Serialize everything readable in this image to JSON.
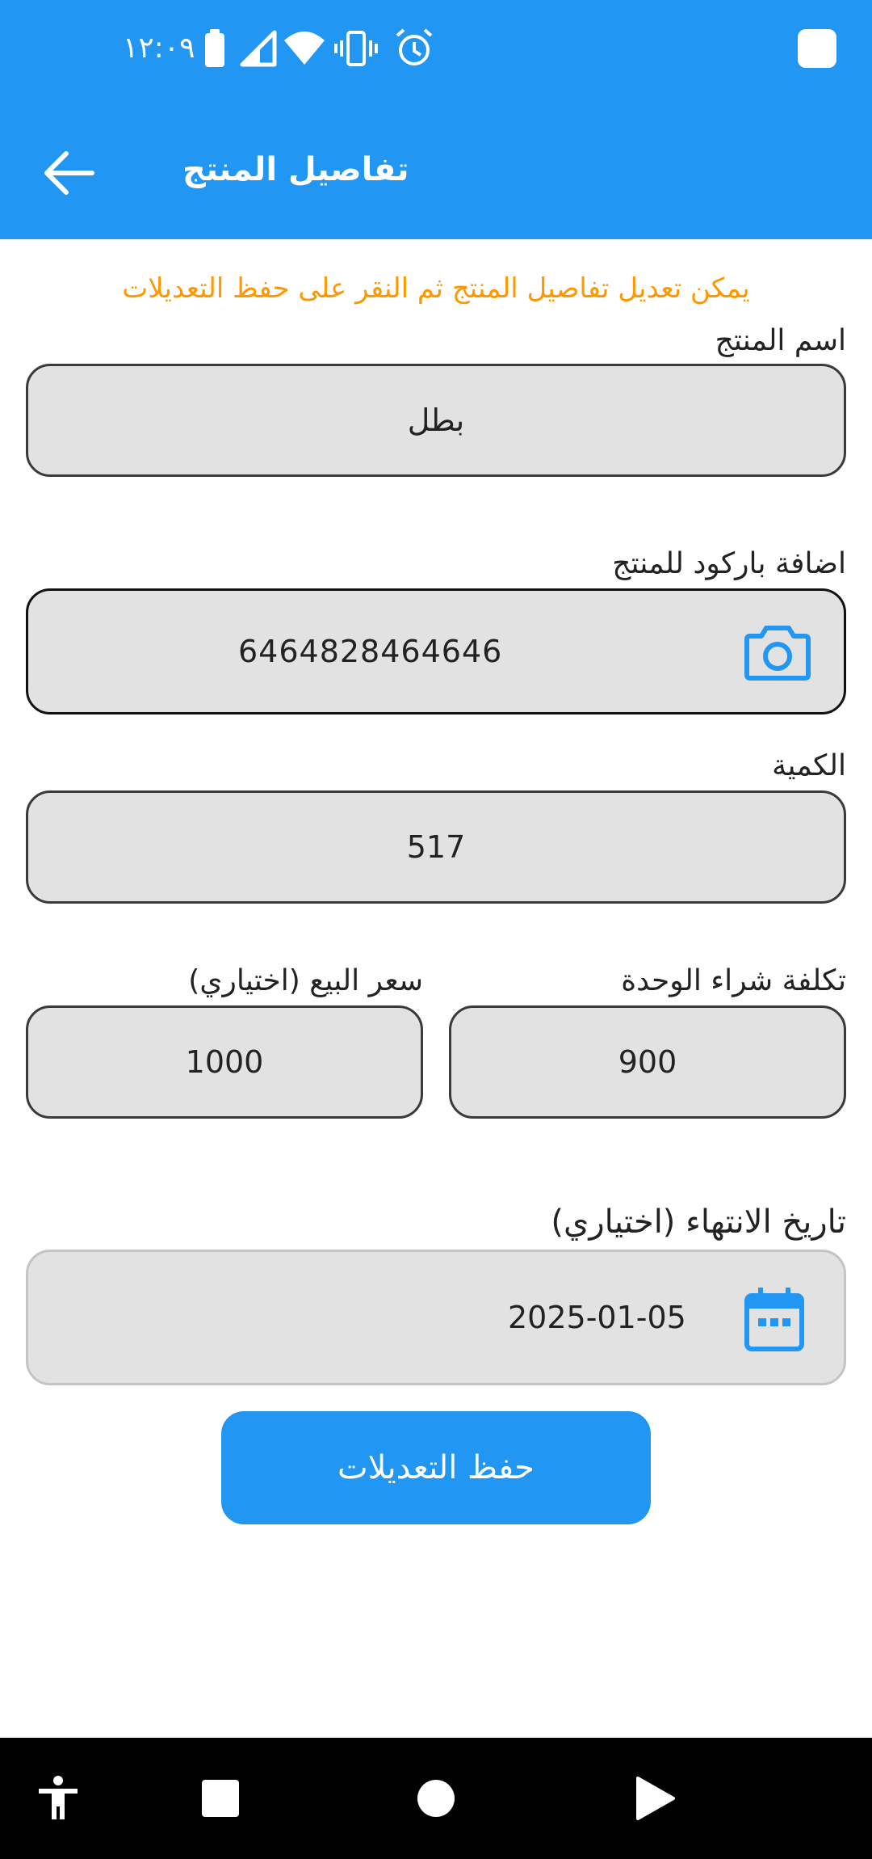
{
  "status_bar": {
    "time": "١٢:٠٩"
  },
  "app_bar": {
    "title": "تفاصيل المنتج"
  },
  "hint": "يمكن تعديل تفاصيل المنتج ثم النقر على حفظ التعديلات",
  "form": {
    "name": {
      "label": "اسم المنتج",
      "value": "بطل"
    },
    "barcode": {
      "label": "اضافة باركود للمنتج",
      "value": "6464828464646"
    },
    "quantity": {
      "label": "الكمية",
      "value": "517"
    },
    "unit_cost": {
      "label": "تكلفة شراء الوحدة",
      "value": "900"
    },
    "sale_price": {
      "label": "سعر البيع (اختياري)",
      "value": "1000"
    },
    "expiry": {
      "label": "تاريخ الانتهاء (اختياري)",
      "value": "2025-01-05"
    }
  },
  "save_button": {
    "label": "حفظ التعديلات"
  },
  "colors": {
    "primary": "#2196F3",
    "hint": "#FF9800",
    "field_bg": "#E2E2E2",
    "nav_bg": "#000000"
  },
  "icons": [
    "battery-icon",
    "signal-icon",
    "wifi-icon",
    "vibrate-icon",
    "alarm-icon",
    "back-arrow-icon",
    "camera-icon",
    "calendar-icon",
    "accessibility-icon",
    "recents-icon",
    "home-icon",
    "back-triangle-icon"
  ]
}
